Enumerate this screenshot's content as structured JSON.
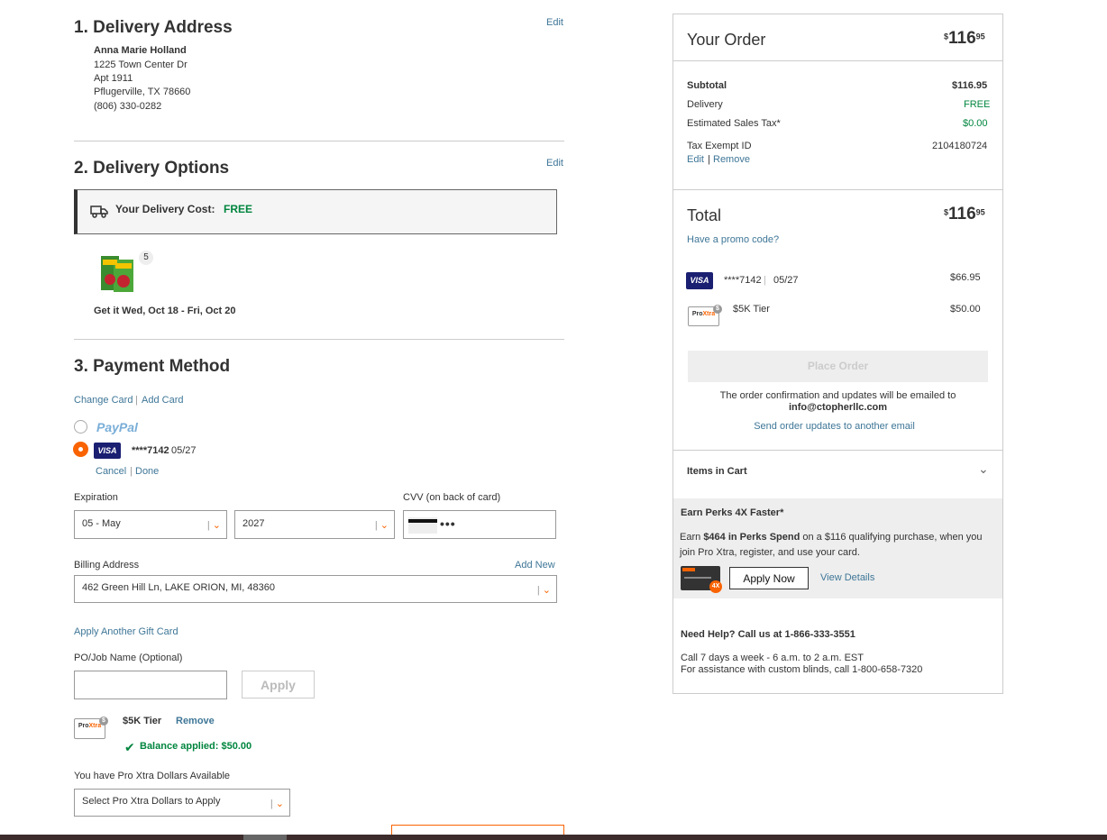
{
  "delivery_address": {
    "heading": "1. Delivery Address",
    "edit": "Edit",
    "name": "Anna Marie Holland",
    "line1": "1225 Town Center Dr",
    "line2": "Apt 1911",
    "city": "Pflugerville, TX 78660",
    "phone": "(806) 330-0282"
  },
  "delivery_options": {
    "heading": "2. Delivery Options",
    "edit": "Edit",
    "cost_label": "Your Delivery Cost:",
    "cost_value": "FREE",
    "item_count": "5",
    "eta": "Get it Wed, Oct 18 - Fri, Oct 20"
  },
  "payment": {
    "heading": "3. Payment Method",
    "change_card": "Change Card",
    "add_card": "Add Card",
    "paypal_label": "PayPal",
    "visa_label": "VISA",
    "card_mask": "****7142",
    "card_exp": "05/27",
    "cancel": "Cancel",
    "done": "Done",
    "expiration_label": "Expiration",
    "month_value": "05 - May",
    "year_value": "2027",
    "cvv_label": "CVV (on back of card)",
    "cvv_value": "•••",
    "billing_label": "Billing Address",
    "add_new": "Add New",
    "billing_value": "462 Green Hill Ln, LAKE ORION, MI, 48360",
    "gift_card": "Apply Another Gift Card",
    "po_label": "PO/Job Name (Optional)",
    "po_value": "",
    "apply": "Apply",
    "tier_label": "$5K Tier",
    "remove": "Remove",
    "balance": "Balance applied: $50.00",
    "pro_xtra_available": "You have Pro Xtra Dollars Available",
    "pro_xtra_select": "Select Pro Xtra Dollars to Apply",
    "badge_num": "$"
  },
  "order": {
    "title": "Your Order",
    "total_dollars": "116",
    "total_cents": "95",
    "currency": "$",
    "subtotal_label": "Subtotal",
    "subtotal_value": "$116.95",
    "delivery_label": "Delivery",
    "delivery_value": "FREE",
    "tax_label": "Estimated Sales Tax*",
    "tax_value": "$0.00",
    "tax_exempt_label": "Tax Exempt ID",
    "tax_exempt_value": "2104180724",
    "edit": "Edit",
    "remove": "Remove",
    "total_label": "Total",
    "promo": "Have a promo code?",
    "pay1_mask": "****7142",
    "pay1_exp": "05/27",
    "pay1_amount": "$66.95",
    "pay2_label": "$5K Tier",
    "pay2_amount": "$50.00",
    "place_order": "Place Order",
    "confirm_text": "The order confirmation and updates will be emailed to",
    "email": "info@ctopherllc.com",
    "send_updates": "Send order updates to another email",
    "items_in_cart": "Items in Cart"
  },
  "perks": {
    "title": "Earn Perks 4X Faster*",
    "text_pre": "Earn",
    "text_amount": "$464 in Perks Spend",
    "text_post": "on a $116 qualifying purchase, when you join Pro Xtra, register, and use your card.",
    "card_badge": "4X",
    "apply_now": "Apply Now",
    "view_details": "View Details"
  },
  "help": {
    "title": "Need Help? Call us at 1-866-333-3551",
    "hours": "Call 7 days a week - 6 a.m. to 2 a.m. EST",
    "blinds": "For assistance with custom blinds, call 1-800-658-7320"
  },
  "colors": {
    "brand_orange": "#f96302",
    "link_blue": "#3e7697",
    "green": "#00853e",
    "visa_blue": "#1a1f71"
  }
}
